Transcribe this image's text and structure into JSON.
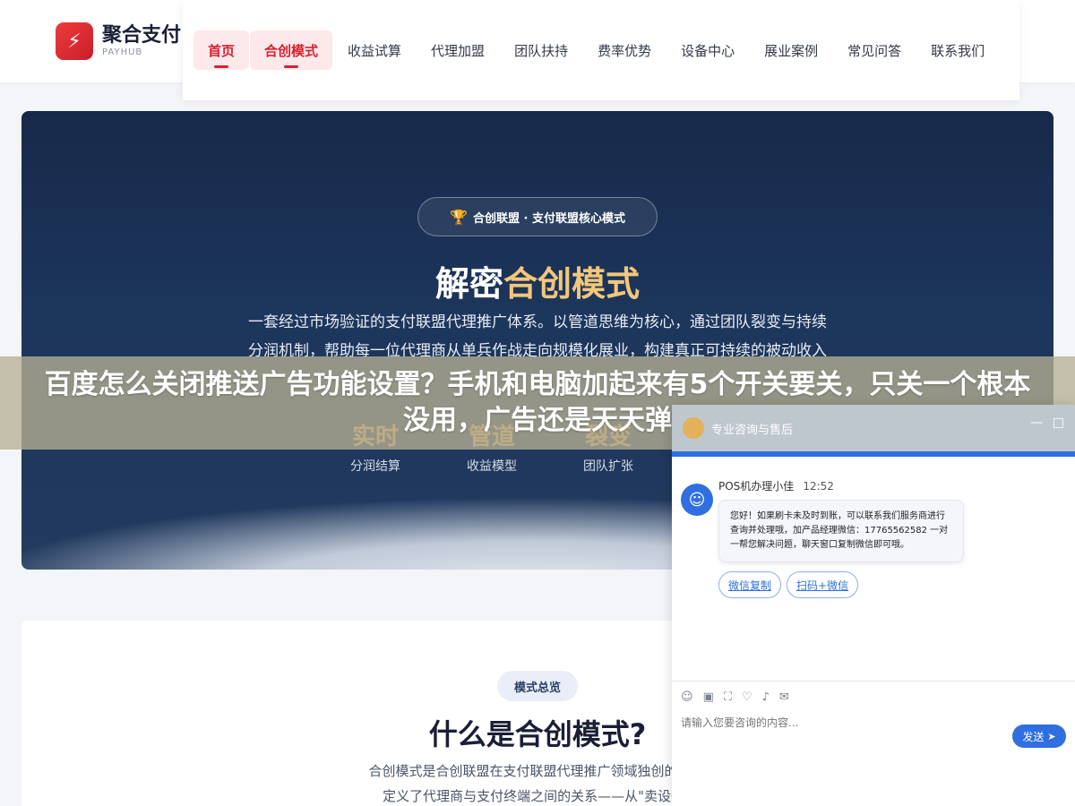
{
  "logo": {
    "icon": "lightning-bolt-icon",
    "glyph": "⚡",
    "name": "聚合支付",
    "sub": "PAYHUB"
  },
  "nav": {
    "items": [
      {
        "label": "首页"
      },
      {
        "label": "合创模式"
      },
      {
        "label": "收益试算"
      },
      {
        "label": "代理加盟"
      },
      {
        "label": "团队扶持"
      },
      {
        "label": "费率优势"
      },
      {
        "label": "设备中心"
      },
      {
        "label": "展业案例"
      },
      {
        "label": "常见问答"
      },
      {
        "label": "联系我们"
      }
    ]
  },
  "hero": {
    "badge": "合创联盟 · 支付联盟核心模式",
    "badge_icon": "trophy-icon",
    "title_plain": "解密",
    "title_accent": "合创模式",
    "desc_line1": "一套经过市场验证的支付联盟代理推广体系。以管道思维为核心，通过团队裂变与持续",
    "desc_line2": "分润机制，帮助每一位代理商从单兵作战走向规模化展业，构建真正可持续的被动收入",
    "stats": [
      {
        "big": "实时",
        "small": "分润结算"
      },
      {
        "big": "管道",
        "small": "收益模型"
      },
      {
        "big": "裂变",
        "small": "团队扩张"
      }
    ]
  },
  "overlay": {
    "text": "百度怎么关闭推送广告功能设置？手机和电脑加起来有5个开关要关，只关一个根本没用，广告还是天天弹"
  },
  "section": {
    "badge": "模式总览",
    "title": "什么是合创模式?",
    "desc_line1": "合创模式是合创联盟在支付联盟代理推广领域独创的一套完整",
    "desc_line2": "定义了代理商与支付终端之间的关系——从\"卖设备\"转变"
  },
  "chat": {
    "header_title": "专业咨询与售后",
    "minimize": "—",
    "maximize": "□",
    "agent_name": "POS机办理小佳",
    "time": "12:52",
    "message": "您好！如果刷卡未及时到账，可以联系我们服务商进行查询并处理哦，加产品经理微信：17765562582 一对一帮您解决问题，聊天窗口复制微信即可哦。",
    "actions": [
      {
        "label": "微信复制"
      },
      {
        "label": "扫码+微信"
      }
    ],
    "tools": [
      "☺",
      "▣",
      "⛶",
      "♡",
      "♪",
      "✉"
    ],
    "input_placeholder": "请输入您要咨询的内容...",
    "send_label": "发送",
    "colors": {
      "accent": "#2f6fe0",
      "header": "#bfc7ce"
    }
  }
}
